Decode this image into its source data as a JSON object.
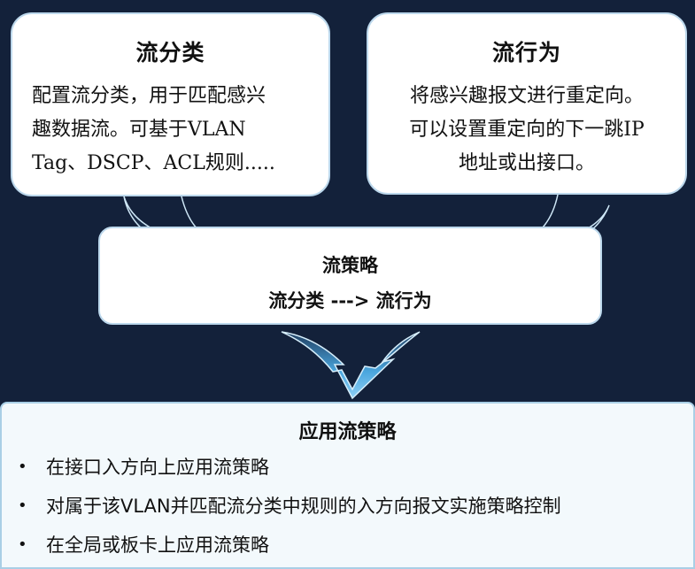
{
  "classifier": {
    "title": "流分类",
    "lines": [
      "配置流分类，用于匹配感兴",
      "趣数据流。可基于VLAN",
      "Tag、DSCP、ACL规则....."
    ]
  },
  "behavior": {
    "title": "流行为",
    "lines": [
      "将感兴趣报文进行重定向。",
      "可以设置重定向的下一跳IP",
      "地址或出接口。"
    ]
  },
  "policy": {
    "title": "流策略",
    "formula": "流分类 ---> 流行为"
  },
  "apply": {
    "title": "应用流策略",
    "items": [
      "在接口入方向上应用流策略",
      "对属于该VLAN并匹配流分类中规则的入方向报文实施策略控制",
      "在全局或板卡上应用流策略"
    ]
  }
}
